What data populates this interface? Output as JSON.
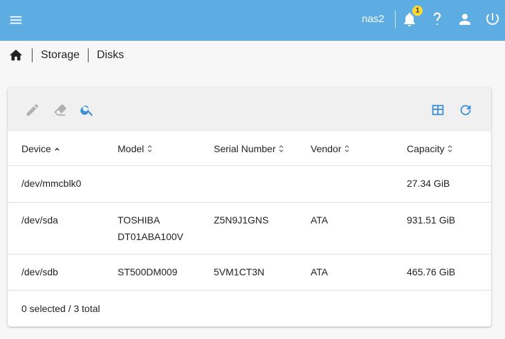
{
  "header": {
    "hostname": "nas2",
    "notification_count": "1"
  },
  "breadcrumb": {
    "items": [
      "Storage",
      "Disks"
    ]
  },
  "table": {
    "columns": [
      "Device",
      "Model",
      "Serial Number",
      "Vendor",
      "Capacity"
    ],
    "sort": {
      "column": "Device",
      "direction": "ascending"
    },
    "rows": [
      {
        "device": "/dev/mmcblk0",
        "model": "",
        "serial": "",
        "vendor": "",
        "capacity": "27.34 GiB"
      },
      {
        "device": "/dev/sda",
        "model_line1": "TOSHIBA",
        "model_line2": "DT01ABA100V",
        "serial": "Z5N9J1GNS",
        "vendor": "ATA",
        "capacity": "931.51 GiB"
      },
      {
        "device": "/dev/sdb",
        "model": "ST500DM009",
        "serial": "5VM1CT3N",
        "vendor": "ATA",
        "capacity": "465.76 GiB"
      }
    ],
    "footer": "0 selected / 3 total"
  },
  "icons": {
    "toolbar": [
      "pencil-icon",
      "eraser-icon",
      "search-icon",
      "table-columns-icon",
      "refresh-icon"
    ],
    "header": [
      "menu-icon",
      "bell-icon",
      "help-icon",
      "user-icon",
      "power-icon"
    ]
  },
  "colors": {
    "header_bg": "#5dade2",
    "accent": "#3d8fd6",
    "disabled_icon": "#b0b0b0",
    "badge": "#fdd835"
  }
}
